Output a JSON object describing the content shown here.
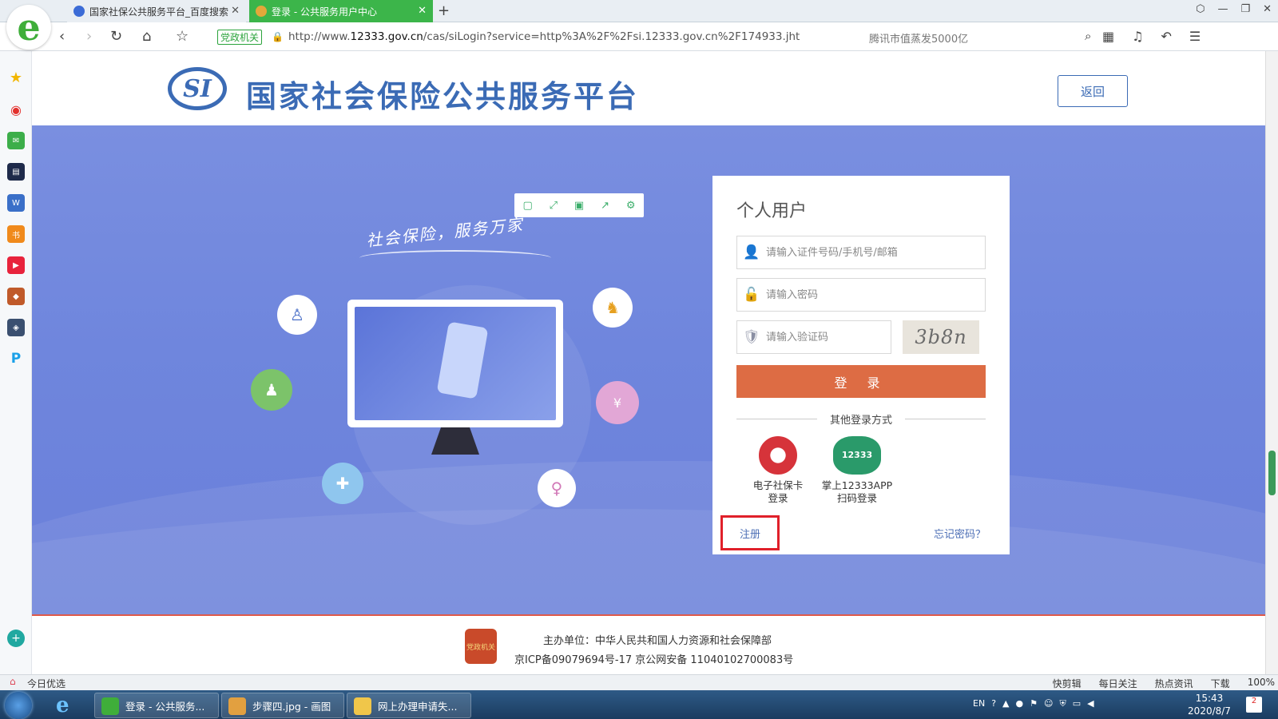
{
  "browser": {
    "tabs": [
      {
        "label": "国家社保公共服务平台_百度搜索"
      },
      {
        "label": "登录 - 公共服务用户中心"
      }
    ],
    "address": {
      "tag": "党政机关",
      "url_prefix": "http://www.",
      "url_domain": "12333.gov.cn",
      "url_rest": "/cas/siLogin?service=http%3A%2F%2Fsi.12333.gov.cn%2F174933.jht"
    },
    "search_hint": "腾讯市值蒸发5000亿"
  },
  "site": {
    "logo_text": "SI",
    "title": "国家社会保险公共服务平台",
    "back_label": "返回",
    "slogan": "社会保险，服务万家"
  },
  "login": {
    "title": "个人用户",
    "id_placeholder": "请输入证件号码/手机号/邮箱",
    "password_placeholder": "请输入密码",
    "captcha_placeholder": "请输入验证码",
    "captcha_text": "3b8n",
    "login_label": "登 录",
    "other_methods": "其他登录方式",
    "alt1_line1": "电子社保卡",
    "alt1_line2": "登录",
    "alt2_line1": "掌上12333APP",
    "alt2_line2": "扫码登录",
    "alt2_badge": "12333",
    "register_label": "注册",
    "forgot_label": "忘记密码？"
  },
  "footer": {
    "emblem_text": "党政机关",
    "line1": "主办单位：中华人民共和国人力资源和社会保障部",
    "line2": "京ICP备09079694号-17  京公网安备 11040102700083号"
  },
  "statusbar": {
    "left": "今日优选",
    "items": [
      "快剪辑",
      "每日关注",
      "热点资讯",
      "下载",
      "100%"
    ]
  },
  "taskbar": {
    "items": [
      {
        "label": "登录 - 公共服务..."
      },
      {
        "label": "步骤四.jpg - 画图"
      },
      {
        "label": "网上办理申请失..."
      }
    ],
    "lang": "EN",
    "time": "15:43",
    "date": "2020/8/7",
    "notif_count": "2"
  },
  "colors": {
    "brand_blue": "#3b6bb5",
    "login_orange": "#dd6c44",
    "banner_blue": "#7086dd",
    "highlight_red": "#e0202a"
  }
}
